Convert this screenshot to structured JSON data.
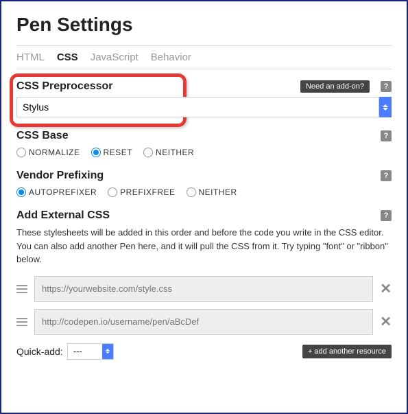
{
  "title": "Pen Settings",
  "tabs": [
    {
      "label": "HTML",
      "active": false
    },
    {
      "label": "CSS",
      "active": true
    },
    {
      "label": "JavaScript",
      "active": false
    },
    {
      "label": "Behavior",
      "active": false
    }
  ],
  "preprocessor": {
    "title": "CSS Preprocessor",
    "addon_label": "Need an add-on?",
    "value": "Stylus"
  },
  "cssBase": {
    "title": "CSS Base",
    "options": [
      {
        "label": "NORMALIZE",
        "checked": false
      },
      {
        "label": "RESET",
        "checked": true
      },
      {
        "label": "NEITHER",
        "checked": false
      }
    ]
  },
  "vendor": {
    "title": "Vendor Prefixing",
    "options": [
      {
        "label": "AUTOPREFIXER",
        "checked": true
      },
      {
        "label": "PREFIXFREE",
        "checked": false
      },
      {
        "label": "NEITHER",
        "checked": false
      }
    ]
  },
  "external": {
    "title": "Add External CSS",
    "description": "These stylesheets will be added in this order and before the code you write in the CSS editor. You can also add another Pen here, and it will pull the CSS from it. Try typing \"font\" or \"ribbon\" below.",
    "resources": [
      {
        "placeholder": "https://yourwebsite.com/style.css"
      },
      {
        "placeholder": "http://codepen.io/username/pen/aBcDef"
      }
    ]
  },
  "quickadd": {
    "label": "Quick-add:",
    "value": "---"
  },
  "addResource": "+ add another resource"
}
